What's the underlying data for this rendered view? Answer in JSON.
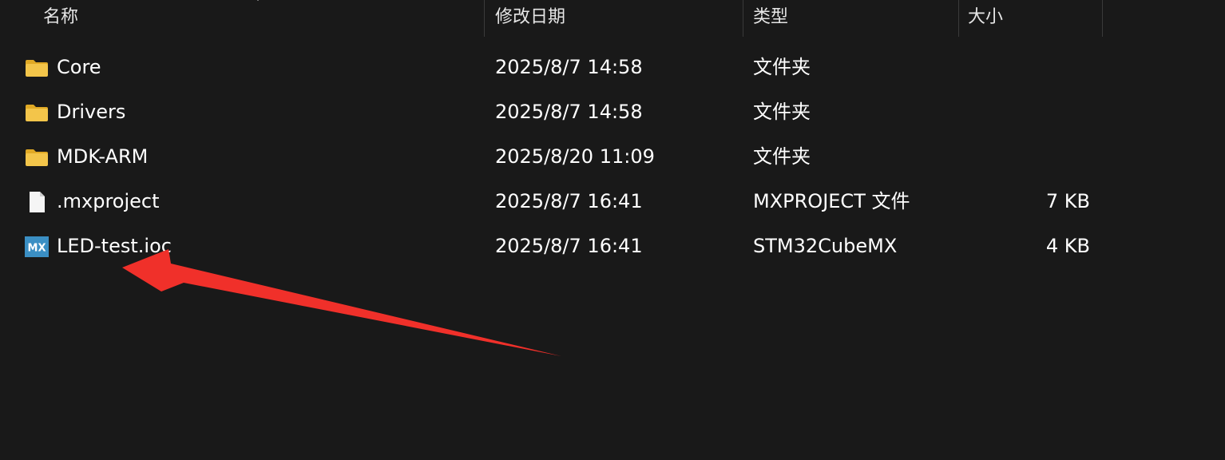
{
  "columns": {
    "name": "名称",
    "modified": "修改日期",
    "type": "类型",
    "size": "大小"
  },
  "rows": [
    {
      "name": "Core",
      "modified": "2025/8/7 14:58",
      "type": "文件夹",
      "size": "",
      "icon": "folder-icon"
    },
    {
      "name": "Drivers",
      "modified": "2025/8/7 14:58",
      "type": "文件夹",
      "size": "",
      "icon": "folder-icon"
    },
    {
      "name": "MDK-ARM",
      "modified": "2025/8/20 11:09",
      "type": "文件夹",
      "size": "",
      "icon": "folder-icon"
    },
    {
      "name": ".mxproject",
      "modified": "2025/8/7 16:41",
      "type": "MXPROJECT 文件",
      "size": "7 KB",
      "icon": "file-icon"
    },
    {
      "name": "LED-test.ioc",
      "modified": "2025/8/7 16:41",
      "type": "STM32CubeMX",
      "size": "4 KB",
      "icon": "mx-icon",
      "icon_text": "MX"
    }
  ],
  "colors": {
    "background": "#191919",
    "folder": "#f3c54a",
    "mx_icon": "#3b8fc4",
    "annotation_arrow": "#f0302a"
  }
}
